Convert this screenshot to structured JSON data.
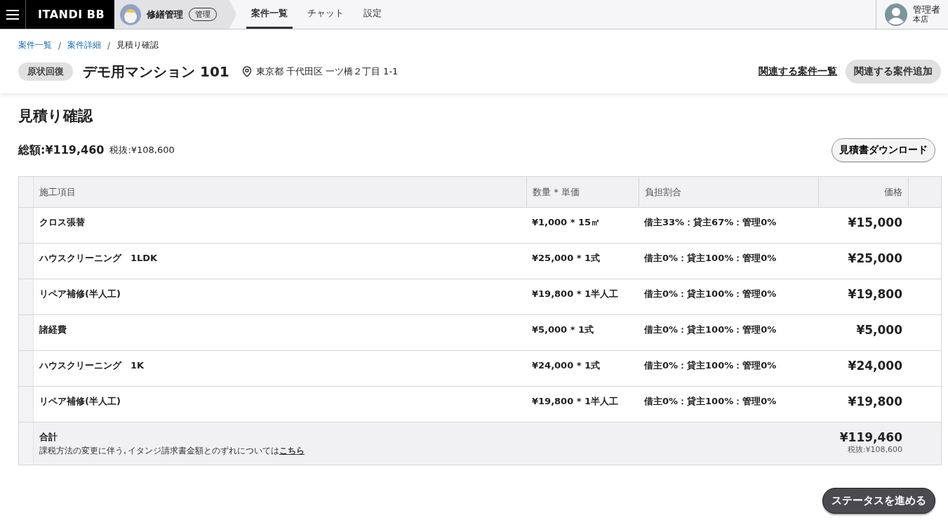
{
  "app": {
    "logo": "ITANDI BB",
    "service": "修繕管理",
    "role_badge": "管理"
  },
  "nav_tabs": [
    {
      "label": "案件一覧",
      "selected": true
    },
    {
      "label": "チャット",
      "selected": false
    },
    {
      "label": "設定",
      "selected": false
    }
  ],
  "user": {
    "name": "管理者",
    "store": "本店"
  },
  "breadcrumbs": [
    "案件一覧",
    "案件詳細",
    "見積り確認"
  ],
  "breadcrumb_separators": [
    "/",
    "/"
  ],
  "property": {
    "category": "原状回復",
    "name": "デモ用マンション 101",
    "address": "東京都 千代田区 一ツ橋２丁目 1-1"
  },
  "header_actions": {
    "link": "関連する案件一覧",
    "button": "関連する案件追加"
  },
  "page_title": "見積り確認",
  "summary": {
    "total": "総額:¥119,460",
    "tax_excluded": "税抜:¥108,600",
    "download_button": "見積書ダウンロード"
  },
  "table": {
    "columns": [
      "施工項目",
      "数量 * 単価",
      "負担割合",
      "価格"
    ],
    "rows": [
      {
        "item": "クロス張替",
        "quantity": "¥1,000 * 15㎡",
        "burden": "借主33%：貸主67%：管理0%",
        "price": "¥15,000"
      },
      {
        "item": "ハウスクリーニング　1LDK",
        "quantity": "¥25,000 * 1式",
        "burden": "借主0%：貸主100%：管理0%",
        "price": "¥25,000"
      },
      {
        "item": "リペア補修(半人工)",
        "quantity": "¥19,800 * 1半人工",
        "burden": "借主0%：貸主100%：管理0%",
        "price": "¥19,800"
      },
      {
        "item": "諸経費",
        "quantity": "¥5,000 * 1式",
        "burden": "借主0%：貸主100%：管理0%",
        "price": "¥5,000"
      },
      {
        "item": "ハウスクリーニング　1K",
        "quantity": "¥24,000 * 1式",
        "burden": "借主0%：貸主100%：管理0%",
        "price": "¥24,000"
      },
      {
        "item": "リペア補修(半人工)",
        "quantity": "¥19,800 * 1半人工",
        "burden": "借主0%：貸主100%：管理0%",
        "price": "¥19,800"
      }
    ],
    "total_row": {
      "label": "合計",
      "note": "課税方法の変更に伴う､イタンジ請求書金額とのずれについては",
      "note_link": "こちら",
      "total": "¥119,460",
      "tax_excluded": "税抜:¥108,600"
    }
  },
  "advance_button": "ステータスを進める"
}
